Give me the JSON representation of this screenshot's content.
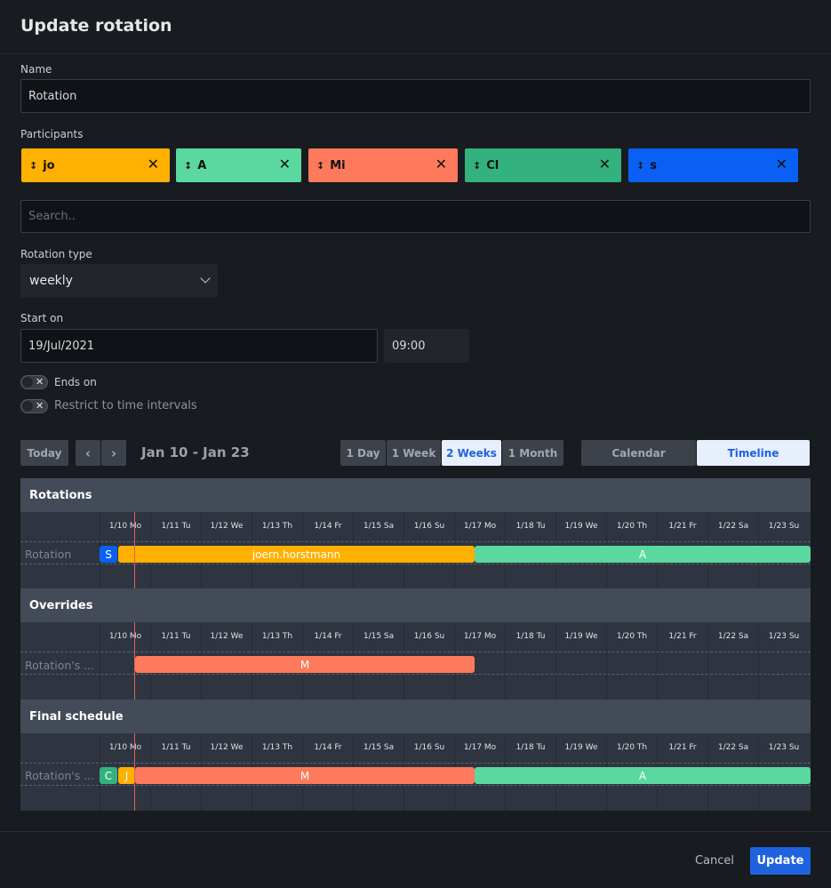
{
  "dialog": {
    "title": "Update rotation"
  },
  "form": {
    "name_label": "Name",
    "name_value": "Rotation",
    "participants_label": "Participants",
    "participants": [
      {
        "label": "jo",
        "color": "#ffb000"
      },
      {
        "label": "A",
        "color": "#5ad8a0"
      },
      {
        "label": "Mi",
        "color": "#ff7a5c"
      },
      {
        "label": "Cl",
        "color": "#33b27f"
      },
      {
        "label": "s",
        "color": "#0a60f5"
      }
    ],
    "search_placeholder": "Search..",
    "rotation_type_label": "Rotation type",
    "rotation_type_value": "weekly",
    "start_on_label": "Start on",
    "start_date": "19/Jul/2021",
    "start_time": "09:00",
    "ends_on_label": "Ends on",
    "restrict_label": "Restrict to time intervals"
  },
  "toolbar": {
    "today": "Today",
    "prev": "‹",
    "next": "›",
    "range": "Jan 10 - Jan 23",
    "views": [
      "1 Day",
      "1 Week",
      "2 Weeks",
      "1 Month"
    ],
    "active_view": "2 Weeks",
    "modes": [
      "Calendar",
      "Timeline"
    ],
    "active_mode": "Timeline"
  },
  "days": [
    "1/10 Mo",
    "1/11 Tu",
    "1/12 We",
    "1/13 Th",
    "1/14 Fr",
    "1/15 Sa",
    "1/16 Su",
    "1/17 Mo",
    "1/18 Tu",
    "1/19 We",
    "1/20 Th",
    "1/21 Fr",
    "1/22 Sa",
    "1/23 Su"
  ],
  "sections": {
    "rotations": {
      "title": "Rotations",
      "row_label": "Rotation"
    },
    "overrides": {
      "title": "Overrides",
      "row_label": "Rotation's ..."
    },
    "final": {
      "title": "Final schedule",
      "row_label": "Rotation's ..."
    }
  },
  "bars": {
    "rotations": [
      {
        "label": "S",
        "color": "#0a60f5"
      },
      {
        "label": "",
        "color": "#ffb000"
      },
      {
        "label": "joern.horstmann",
        "color": "#ffb000"
      },
      {
        "label": "A",
        "color": "#5ad8a0"
      }
    ],
    "overrides": [
      {
        "label": "M",
        "color": "#ff7a5c"
      }
    ],
    "final": [
      {
        "label": "C",
        "color": "#33b27f"
      },
      {
        "label": "J",
        "color": "#ffb000"
      },
      {
        "label": "M",
        "color": "#ff7a5c"
      },
      {
        "label": "A",
        "color": "#5ad8a0"
      }
    ]
  },
  "footer": {
    "cancel": "Cancel",
    "update": "Update"
  }
}
